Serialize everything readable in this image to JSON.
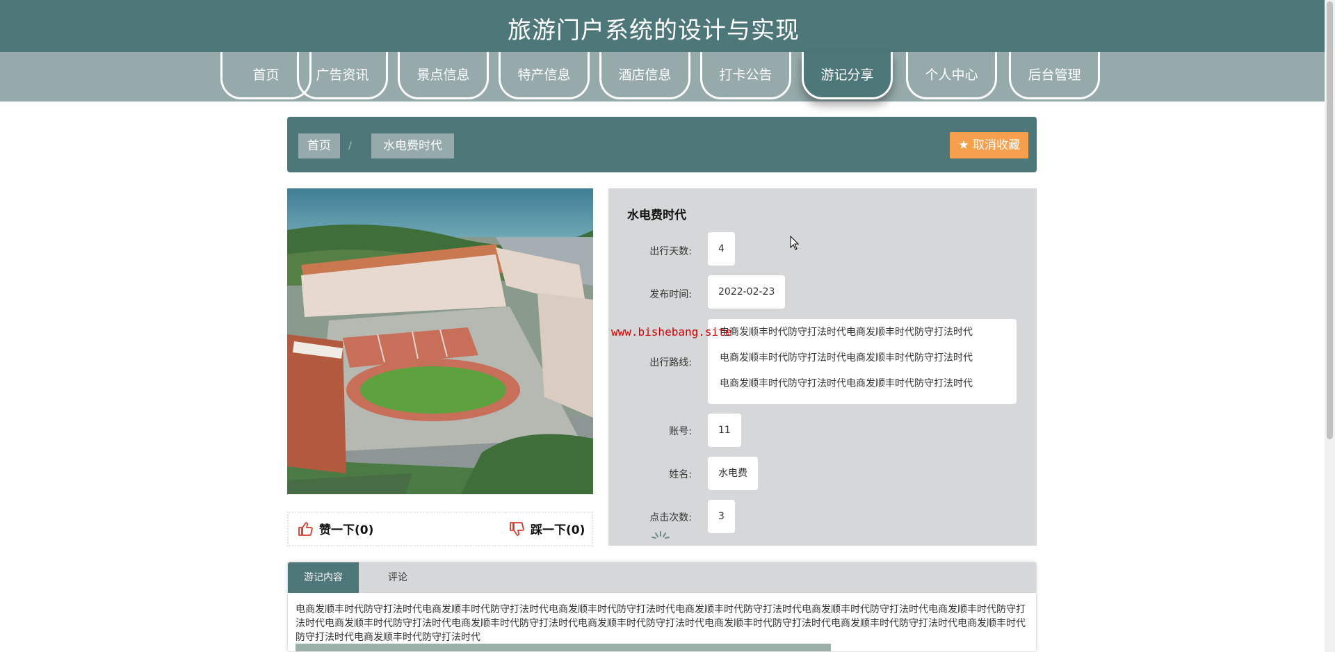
{
  "header": {
    "site_title": "旅游门户系统的设计与实现",
    "brand_color": "#4e7779",
    "nav": [
      {
        "label": "首页",
        "active": false
      },
      {
        "label": "广告资讯",
        "active": false
      },
      {
        "label": "景点信息",
        "active": false
      },
      {
        "label": "特产信息",
        "active": false
      },
      {
        "label": "酒店信息",
        "active": false
      },
      {
        "label": "打卡公告",
        "active": false
      },
      {
        "label": "游记分享",
        "active": true
      },
      {
        "label": "个人中心",
        "active": false
      },
      {
        "label": "后台管理",
        "active": false
      }
    ]
  },
  "breadcrumb": {
    "home": "首页",
    "separator": "/",
    "current": "水电费时代",
    "favorite_button": "取消收藏",
    "favorite_icon": "star-icon",
    "favorite_color": "#f6a04d"
  },
  "votes": {
    "like_label": "赞一下(0)",
    "like_icon": "thumbs-up-icon",
    "dislike_label": "踩一下(0)",
    "dislike_icon": "thumbs-down-icon"
  },
  "detail": {
    "title": "水电费时代",
    "fields": {
      "days_label": "出行天数:",
      "days_value": "4",
      "publish_label": "发布时间:",
      "publish_value": "2022-02-23",
      "route_label": "出行路线:",
      "route_lines": [
        "电商发顺丰时代防守打法时代电商发顺丰时代防守打法时代",
        "电商发顺丰时代防守打法时代电商发顺丰时代防守打法时代",
        "电商发顺丰时代防守打法时代电商发顺丰时代防守打法时代"
      ],
      "account_label": "账号:",
      "account_value": "11",
      "name_label": "姓名:",
      "name_value": "水电费",
      "clicks_label": "点击次数:",
      "clicks_value": "3"
    }
  },
  "watermark": "www.bishebang.site",
  "tabs": {
    "items": [
      {
        "label": "游记内容",
        "active": true
      },
      {
        "label": "评论",
        "active": false
      }
    ],
    "content": "电商发顺丰时代防守打法时代电商发顺丰时代防守打法时代电商发顺丰时代防守打法时代电商发顺丰时代防守打法时代电商发顺丰时代防守打法时代电商发顺丰时代防守打法时代电商发顺丰时代防守打法时代电商发顺丰时代防守打法时代电商发顺丰时代防守打法时代电商发顺丰时代防守打法时代电商发顺丰时代防守打法时代电商发顺丰时代防守打法时代电商发顺丰时代防守打法时代"
  }
}
